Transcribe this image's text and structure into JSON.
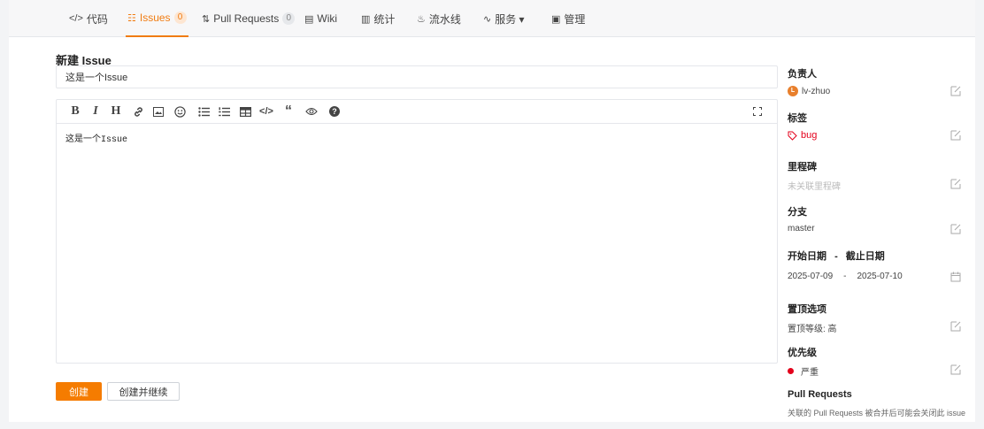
{
  "tabs": [
    {
      "icon": "</>",
      "label": "代码"
    },
    {
      "icon": "☷",
      "label": "Issues",
      "count": "0"
    },
    {
      "icon": "⇅",
      "label": "Pull Requests",
      "count": "0"
    },
    {
      "icon": "▤",
      "label": "Wiki"
    },
    {
      "icon": "▥",
      "label": "统计"
    },
    {
      "icon": "♨",
      "label": "流水线"
    },
    {
      "icon": "∿",
      "label": "服务 ▾"
    },
    {
      "icon": "▣",
      "label": "管理"
    }
  ],
  "form": {
    "page_title": "新建 Issue",
    "title_value": "这是一个Issue",
    "editor_content": "这是一个Issue",
    "create_label": "创建",
    "create_continue_label": "创建并继续"
  },
  "toolbar_icons": [
    "bold",
    "italic",
    "heading",
    "link",
    "image",
    "emoji",
    "bullet-list",
    "ordered-list",
    "table",
    "code",
    "quote",
    "preview",
    "help",
    "fullscreen"
  ],
  "sidebar": {
    "assignee": {
      "title": "负责人",
      "avatar": "L",
      "value": "lv-zhuo"
    },
    "labels": {
      "title": "标签",
      "value": "bug",
      "color": "#e3001b"
    },
    "milestone": {
      "title": "里程碑",
      "value": "未关联里程碑"
    },
    "branch": {
      "title": "分支",
      "value": "master"
    },
    "dates": {
      "title_start": "开始日期",
      "separator": "-",
      "title_end": "截止日期",
      "start": "2025-07-09",
      "range_sep": "-",
      "end": "2025-07-10"
    },
    "pin": {
      "title": "置顶选项",
      "value": "置顶等级: 高"
    },
    "priority": {
      "title": "优先级",
      "value": "严重",
      "color": "#e3001b"
    },
    "pull_requests": {
      "title": "Pull Requests",
      "value": "关联的 Pull Requests 被合并后可能会关闭此 issue"
    }
  },
  "colors": {
    "accent": "#f57c00"
  }
}
